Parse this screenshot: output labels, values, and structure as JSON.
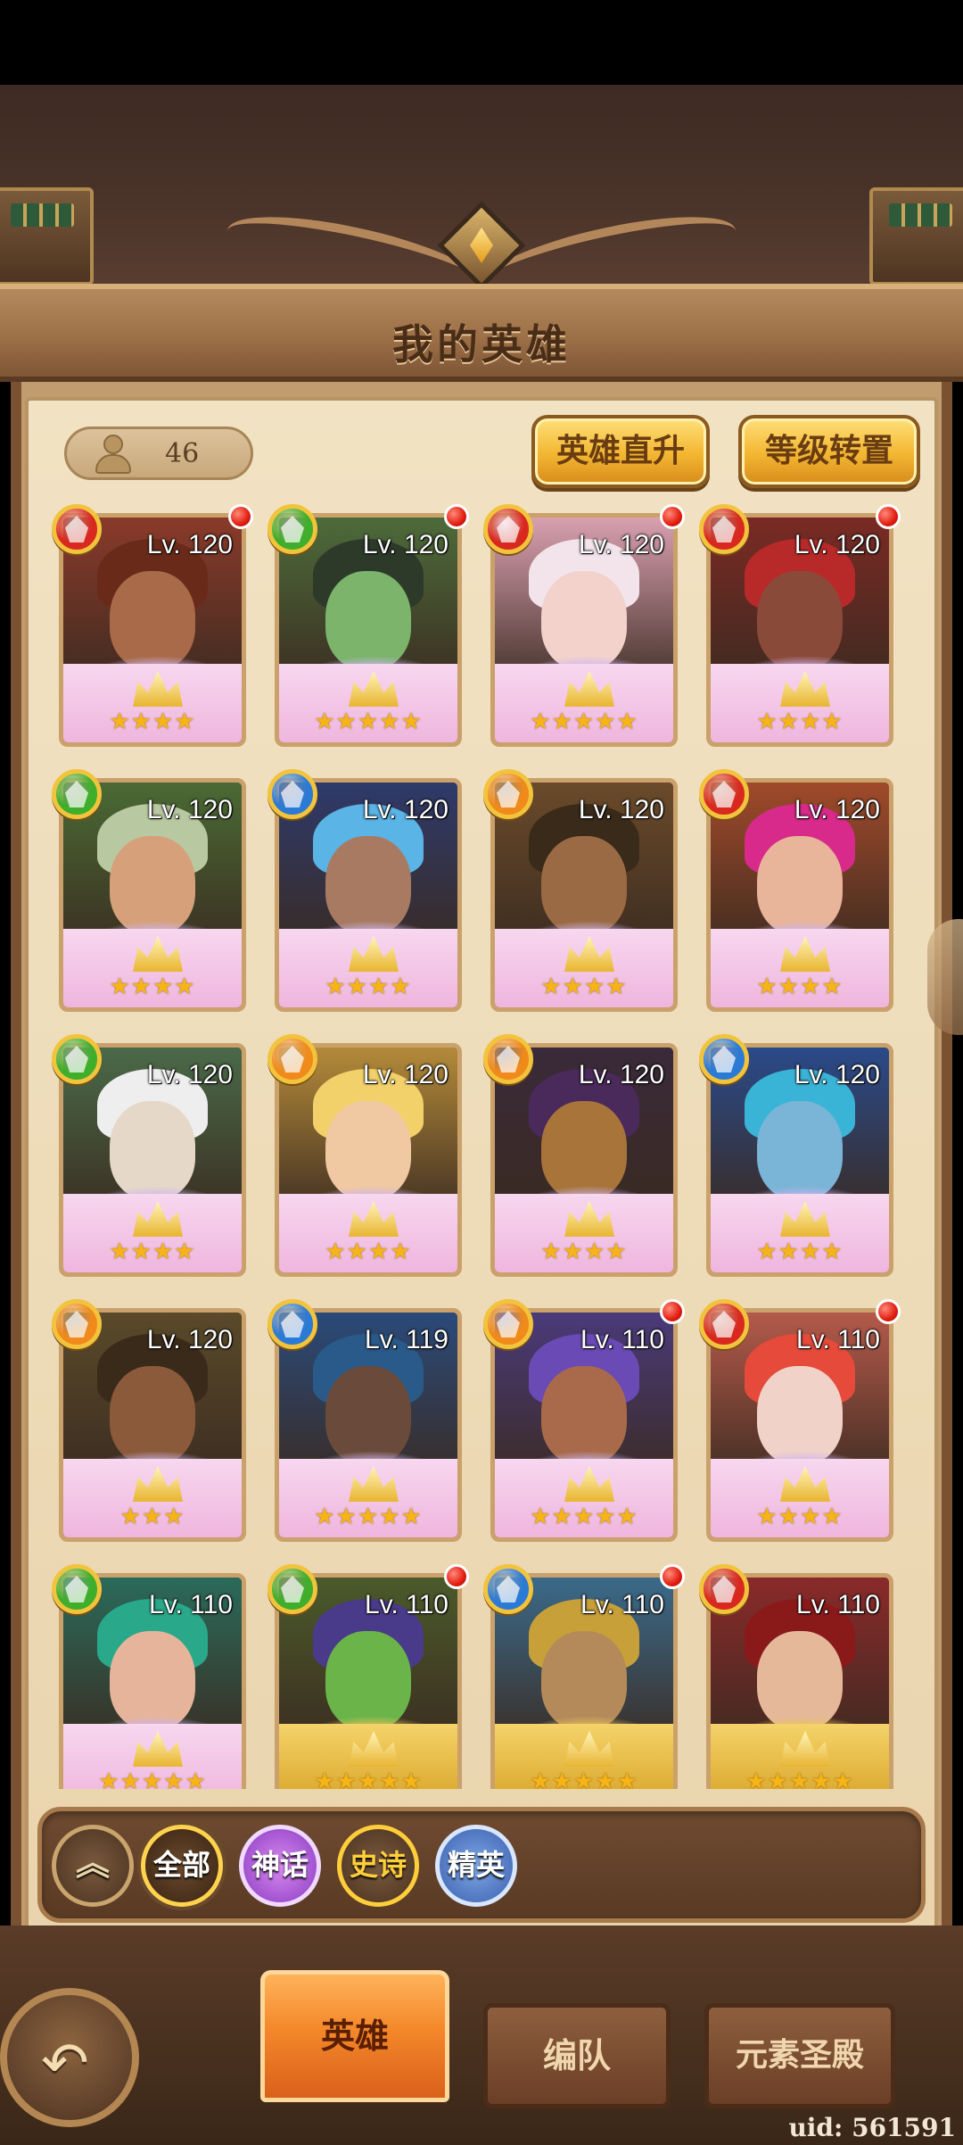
{
  "header": {
    "title": "我的英雄"
  },
  "hero_count": "46",
  "actions": {
    "level_up": "英雄直升",
    "level_transfer": "等级转置"
  },
  "heroes": [
    {
      "level": "Lv. 120",
      "element": "fire",
      "stars": "★★★★",
      "badge": true,
      "tone": "#8a3a2a",
      "skin": "#a86a48",
      "hair": "#6a2a1a"
    },
    {
      "level": "Lv. 120",
      "element": "wind",
      "stars": "★★★★★",
      "badge": true,
      "tone": "#4d6b3a",
      "skin": "#7bb46a",
      "hair": "#2d3a2a"
    },
    {
      "level": "Lv. 120",
      "element": "fire",
      "stars": "★★★★★",
      "badge": true,
      "tone": "#d9a0b0",
      "skin": "#f3d2cc",
      "hair": "#f2e4ea"
    },
    {
      "level": "Lv. 120",
      "element": "fire",
      "stars": "★★★★",
      "badge": true,
      "tone": "#7a2a24",
      "skin": "#8a4a3a",
      "hair": "#b82a2a"
    },
    {
      "level": "Lv. 120",
      "element": "wind",
      "stars": "★★★★",
      "badge": false,
      "tone": "#4a6a34",
      "skin": "#d6a07a",
      "hair": "#b8c8a0"
    },
    {
      "level": "Lv. 120",
      "element": "water",
      "stars": "★★★★",
      "badge": false,
      "tone": "#2e3a6a",
      "skin": "#a87a62",
      "hair": "#5ab4e6"
    },
    {
      "level": "Lv. 120",
      "element": "light",
      "stars": "★★★★",
      "badge": false,
      "tone": "#6a4a2a",
      "skin": "#9a6a44",
      "hair": "#3a2a1a"
    },
    {
      "level": "Lv. 120",
      "element": "fire",
      "stars": "★★★★",
      "badge": false,
      "tone": "#a04a2a",
      "skin": "#e8b49a",
      "hair": "#d82a8a"
    },
    {
      "level": "Lv. 120",
      "element": "wind",
      "stars": "★★★★",
      "badge": false,
      "tone": "#4a6a48",
      "skin": "#e6d8c8",
      "hair": "#eeeeee"
    },
    {
      "level": "Lv. 120",
      "element": "light",
      "stars": "★★★★",
      "badge": false,
      "tone": "#b48a3a",
      "skin": "#f0c8a2",
      "hair": "#f2d06a"
    },
    {
      "level": "Lv. 120",
      "element": "light",
      "stars": "★★★★",
      "badge": false,
      "tone": "#3a2a3a",
      "skin": "#a8743a",
      "hair": "#4a2a5a"
    },
    {
      "level": "Lv. 120",
      "element": "water",
      "stars": "★★★★",
      "badge": false,
      "tone": "#2a4a8a",
      "skin": "#7ab4d6",
      "hair": "#3ab4d6"
    },
    {
      "level": "Lv. 120",
      "element": "light",
      "stars": "★★★",
      "badge": false,
      "tone": "#5a4a2a",
      "skin": "#8a5a3a",
      "hair": "#3a2a1a"
    },
    {
      "level": "Lv. 119",
      "element": "water",
      "stars": "★★★★★",
      "badge": false,
      "tone": "#2a4a7a",
      "skin": "#6a4a3a",
      "hair": "#2a5a8a"
    },
    {
      "level": "Lv. 110",
      "element": "light",
      "stars": "★★★★★",
      "badge": true,
      "tone": "#4a3a7a",
      "skin": "#a86a4a",
      "hair": "#6a4ab4"
    },
    {
      "level": "Lv. 110",
      "element": "fire",
      "stars": "★★★★",
      "badge": true,
      "tone": "#b45a4a",
      "skin": "#f0d2c8",
      "hair": "#e64a3a"
    },
    {
      "level": "Lv. 110",
      "element": "wind",
      "stars": "★★★★★",
      "badge": false,
      "tone": "#2a6a5a",
      "skin": "#e6b49a",
      "hair": "#2aa88a",
      "gold": false
    },
    {
      "level": "Lv. 110",
      "element": "wind",
      "stars": "★★★★★",
      "badge": true,
      "tone": "#4a5a2a",
      "skin": "#6ab44a",
      "hair": "#4a3a8a",
      "gold": true
    },
    {
      "level": "Lv. 110",
      "element": "water",
      "stars": "★★★★★",
      "badge": true,
      "tone": "#3a6a8a",
      "skin": "#b48a5a",
      "hair": "#c8a03a",
      "gold": true
    },
    {
      "level": "Lv. 110",
      "element": "fire",
      "stars": "★★★★★",
      "badge": false,
      "tone": "#8a2a2a",
      "skin": "#e6b89a",
      "hair": "#8a1a1a",
      "gold": true
    }
  ],
  "element_colors": {
    "fire": "#d9281e",
    "wind": "#3fae2a",
    "water": "#2a7ad6",
    "light": "#f08a1a"
  },
  "filters": {
    "collapse_icon": "double-chevron-up-icon",
    "all": "全部",
    "mythic": "神话",
    "epic": "史诗",
    "elite": "精英"
  },
  "nav": {
    "heroes": "英雄",
    "formation": "编队",
    "elemental_temple": "元素圣殿",
    "back_icon": "back-arrow-icon"
  },
  "uid": "uid: 561591"
}
